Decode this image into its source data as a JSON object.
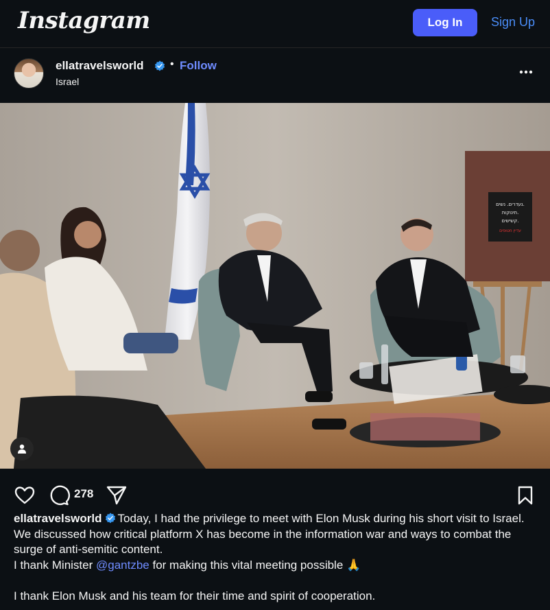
{
  "header": {
    "logo": "Instagram",
    "login_label": "Log In",
    "signup_label": "Sign Up"
  },
  "post": {
    "username": "ellatravelsworld",
    "separator": "•",
    "follow_label": "Follow",
    "location": "Israel",
    "poster_text": "נעדרים. נשים. תינוקות. קשישים. עדיין חטופים על ידי חמאס",
    "comment_count": "278",
    "caption": {
      "username": "ellatravelsworld",
      "line1": "Today, I had the privilege to meet with Elon Musk during his short visit to Israel. We discussed how critical platform X has become in the information war and ways to combat the surge of anti-semitic content.",
      "thanks_pre": "I thank Minister ",
      "mention": "@gantzbe",
      "thanks_post": " for making this vital meeting possible 🙏",
      "line3": "I thank Elon Musk and his team for their time and spirit of cooperation."
    }
  },
  "colors": {
    "background": "#0c1014",
    "login_button": "#4a5df9",
    "link_blue": "#6f8cff",
    "verified": "#3797f0"
  },
  "icons": [
    "verified-badge-icon",
    "more-options-icon",
    "like-heart-icon",
    "comment-bubble-icon",
    "share-paper-plane-icon",
    "save-bookmark-icon",
    "user-tag-icon"
  ]
}
